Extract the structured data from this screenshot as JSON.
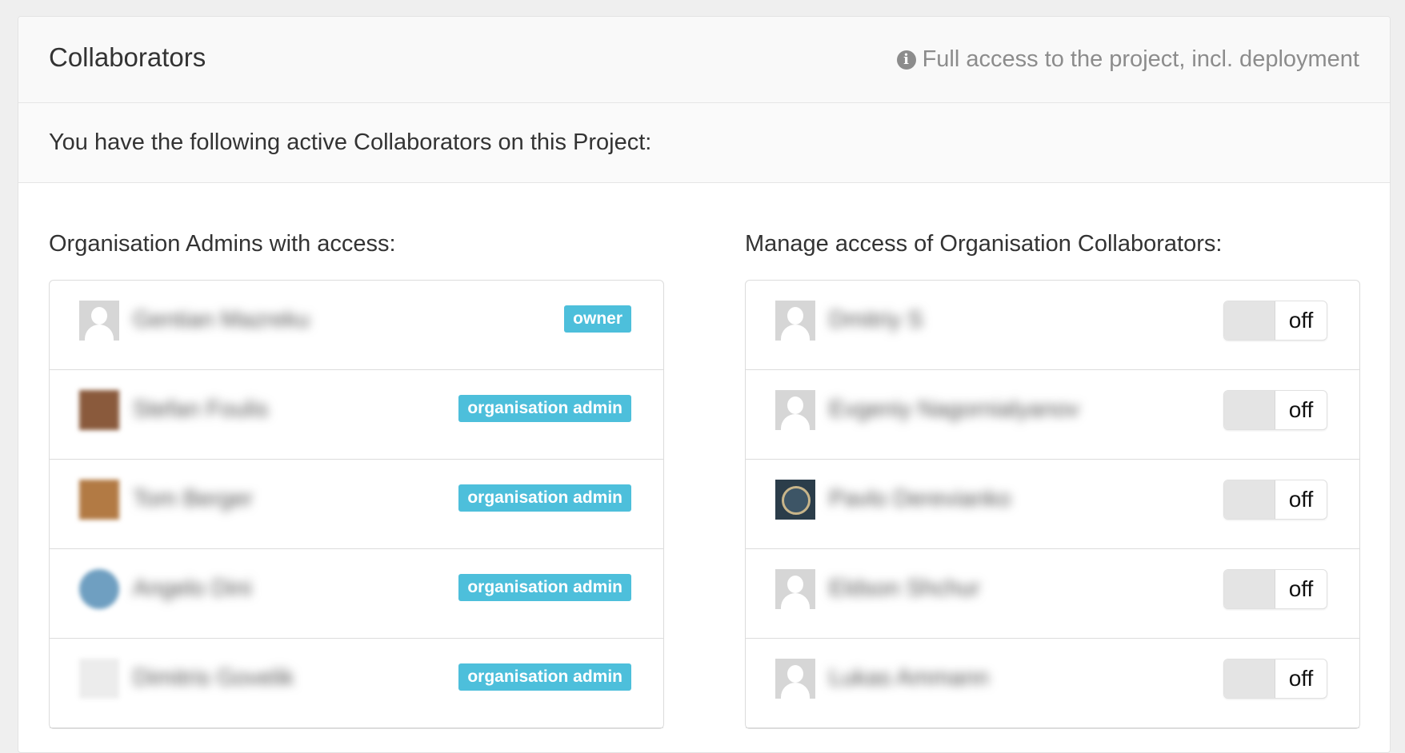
{
  "header": {
    "title": "Collaborators",
    "hint": "Full access to the project, incl. deployment",
    "hint_icon": "info-icon"
  },
  "subheader": {
    "text": "You have the following active Collaborators on this Project:"
  },
  "admins": {
    "title": "Organisation Admins with access:",
    "rows": [
      {
        "name": "Gentian Mazreku",
        "badge": "owner"
      },
      {
        "name": "Stefan Foulis",
        "badge": "organisation admin"
      },
      {
        "name": "Tom Berger",
        "badge": "organisation admin"
      },
      {
        "name": "Angelo Dini",
        "badge": "organisation admin"
      },
      {
        "name": "Dimitris Govelik",
        "badge": "organisation admin"
      }
    ]
  },
  "collaborators": {
    "title": "Manage access of Organisation Collaborators:",
    "rows": [
      {
        "name": "Dmitriy S",
        "toggle": "off"
      },
      {
        "name": "Evgeniy Nagornialyanov",
        "toggle": "off"
      },
      {
        "name": "Pavlo Derevianko",
        "toggle": "off"
      },
      {
        "name": "Eldson Shchur",
        "toggle": "off"
      },
      {
        "name": "Lukas Ammann",
        "toggle": "off"
      }
    ]
  },
  "colors": {
    "badge": "#4dbfdb",
    "background": "#efefef",
    "header_bg": "#f9f9f9"
  }
}
